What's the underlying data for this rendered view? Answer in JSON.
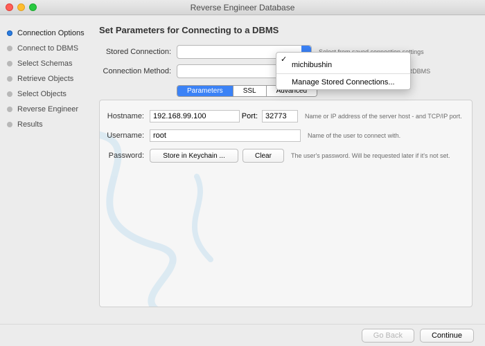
{
  "window": {
    "title": "Reverse Engineer Database"
  },
  "sidebar": {
    "items": [
      {
        "label": "Connection Options",
        "active": true
      },
      {
        "label": "Connect to DBMS"
      },
      {
        "label": "Select Schemas"
      },
      {
        "label": "Retrieve Objects"
      },
      {
        "label": "Select Objects"
      },
      {
        "label": "Reverse Engineer"
      },
      {
        "label": "Results"
      }
    ]
  },
  "main": {
    "heading": "Set Parameters for Connecting to a DBMS",
    "stored_label": "Stored Connection:",
    "stored_hint": "Select from saved connection settings",
    "method_label": "Connection Method:",
    "method_hint": "Method to use to connect to the RDBMS",
    "dropdown": {
      "blank": "",
      "opt1": "michibushin",
      "manage": "Manage Stored Connections..."
    },
    "tabs": {
      "parameters": "Parameters",
      "ssl": "SSL",
      "advanced": "Advanced"
    },
    "fields": {
      "hostname_label": "Hostname:",
      "hostname": "192.168.99.100",
      "port_label": "Port:",
      "port": "32773",
      "host_hint": "Name or IP address of the server host - and TCP/IP port.",
      "username_label": "Username:",
      "username": "root",
      "user_hint": "Name of the user to connect with.",
      "password_label": "Password:",
      "store": "Store in Keychain ...",
      "clear": "Clear",
      "pass_hint": "The user's password. Will be requested later if it's not set."
    }
  },
  "footer": {
    "back": "Go Back",
    "cont": "Continue"
  }
}
